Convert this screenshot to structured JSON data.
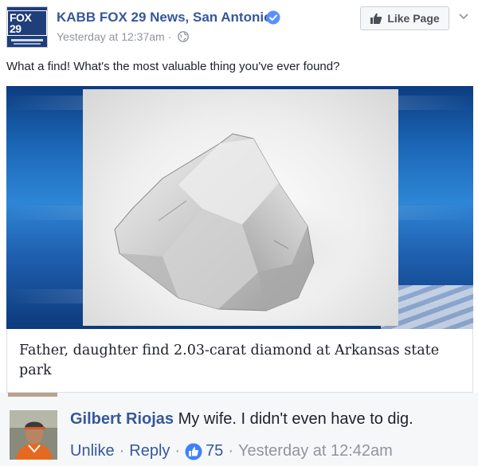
{
  "post": {
    "page_name": "KABB FOX 29 News, San Antonio",
    "avatar_text": "FOX 29",
    "timestamp": "Yesterday at 12:37am",
    "meta_separator": "·",
    "like_page_label": "Like Page",
    "caption": "What a find! What's the most valuable thing you've ever found?",
    "link_title": "Father, daughter find 2.03-carat diamond at Arkansas state park"
  },
  "comment": {
    "author": "Gilbert Riojas",
    "text": "My wife. I didn't even have to dig.",
    "unlike_label": "Unlike",
    "reply_label": "Reply",
    "separator": "·",
    "like_count": "75",
    "timestamp": "Yesterday at 12:42am"
  },
  "icons": {
    "verified": "verified-check-icon",
    "globe": "globe-icon",
    "like_page": "thumbs-up-icon",
    "menu": "chevron-down-icon",
    "reaction": "like-reaction-icon"
  },
  "colors": {
    "link_blue": "#365899",
    "meta_gray": "#90949c",
    "verified_blue": "#5890ff",
    "like_blue": "#4080ff"
  }
}
